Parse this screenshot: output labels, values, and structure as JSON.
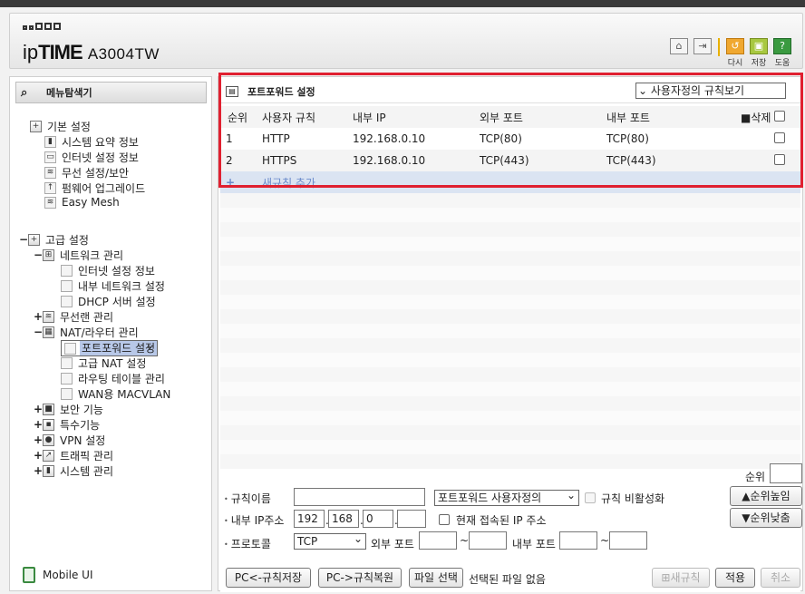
{
  "header": {
    "brand_ip": "ip",
    "brand_time": "TIME",
    "model": "A3004TW",
    "icons": [
      {
        "name": "home-icon",
        "label": ""
      },
      {
        "name": "logout-icon",
        "label": ""
      },
      {
        "name": "restart-icon",
        "label": "다시"
      },
      {
        "name": "save-icon",
        "label": "저장"
      },
      {
        "name": "help-icon",
        "label": "도움"
      }
    ]
  },
  "sidebar": {
    "title": "메뉴탐색기",
    "basic": {
      "label": "기본 설정",
      "items": [
        "시스템 요약 정보",
        "인터넷 설정 정보",
        "무선 설정/보안",
        "펌웨어 업그레이드",
        "Easy Mesh"
      ]
    },
    "advanced": {
      "toggle": "−",
      "label": "고급 설정",
      "network": {
        "toggle": "−",
        "label": "네트워크 관리",
        "items": [
          "인터넷 설정 정보",
          "내부 네트워크 설정",
          "DHCP 서버 설정"
        ]
      },
      "wireless": {
        "toggle": "+",
        "label": "무선랜 관리"
      },
      "nat": {
        "toggle": "−",
        "label": "NAT/라우터 관리",
        "items": [
          "포트포워드 설정",
          "고급 NAT 설정",
          "라우팅 테이블 관리",
          "WAN용 MACVLAN"
        ]
      },
      "security": {
        "toggle": "+",
        "label": "보안 기능"
      },
      "special": {
        "toggle": "+",
        "label": "특수기능"
      },
      "vpn": {
        "toggle": "+",
        "label": "VPN 설정"
      },
      "traffic": {
        "toggle": "+",
        "label": "트래픽 관리"
      },
      "system": {
        "toggle": "+",
        "label": "시스템 관리"
      }
    },
    "mobile_ui": "Mobile UI"
  },
  "main": {
    "title": "포트포워드 설정",
    "view_select": "사용자정의 규칙보기",
    "columns": {
      "seq": "순위",
      "name": "사용자 규칙",
      "internal_ip": "내부 IP",
      "external_port": "외부 포트",
      "internal_port": "내부 포트",
      "delete": "삭제"
    },
    "rules": [
      {
        "seq": "1",
        "name": "HTTP",
        "internal_ip": "192.168.0.10",
        "external_port": "TCP(80)",
        "internal_port": "TCP(80)"
      },
      {
        "seq": "2",
        "name": "HTTPS",
        "internal_ip": "192.168.0.10",
        "external_port": "TCP(443)",
        "internal_port": "TCP(443)"
      }
    ],
    "add_plus": "+",
    "add_label": "새규칙 추가"
  },
  "form": {
    "rule_name_label": "규칙이름",
    "rule_name_value": "",
    "rule_type_select": "포트포워드 사용자정의",
    "disable_label": "규칙 비활성화",
    "internal_ip_label": "내부 IP주소",
    "ip": [
      "192",
      "168",
      "0",
      ""
    ],
    "current_ip_label": "현재 접속된 IP 주소",
    "protocol_label": "프로토콜",
    "protocol_select": "TCP",
    "external_port_label": "외부 포트",
    "internal_port_label": "내부 포트",
    "tilde": "~",
    "order_label": "순위",
    "order_value": "",
    "order_up": "순위높임",
    "order_down": "순위낮춤",
    "btn_pc_save": "PC<-규칙저장",
    "btn_pc_restore": "PC->규칙복원",
    "btn_file": "파일 선택",
    "file_status": "선택된 파일 없음",
    "btn_new": "새규칙",
    "btn_apply": "적용",
    "btn_cancel": "취소"
  }
}
